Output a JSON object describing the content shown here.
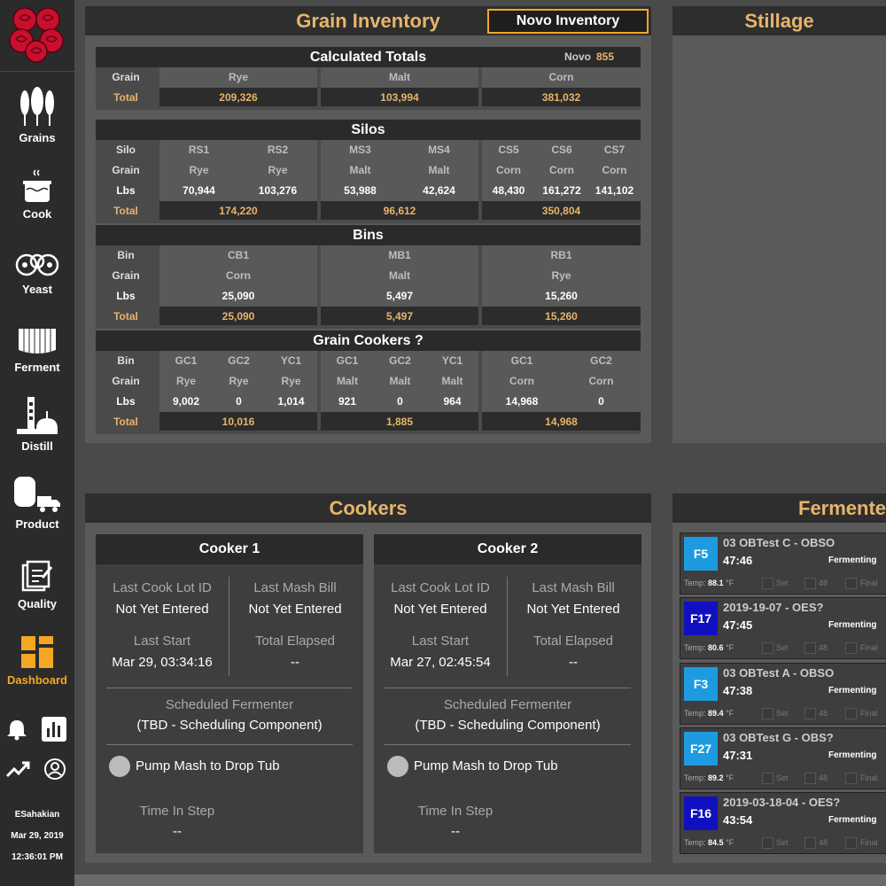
{
  "sidebar": {
    "items": [
      {
        "label": "Grains"
      },
      {
        "label": "Cook"
      },
      {
        "label": "Yeast"
      },
      {
        "label": "Ferment"
      },
      {
        "label": "Distill"
      },
      {
        "label": "Product"
      },
      {
        "label": "Quality"
      },
      {
        "label": "Dashboard"
      }
    ],
    "user": {
      "name": "ESahakian",
      "date": "Mar 29, 2019",
      "time": "12:36:01 PM"
    },
    "accent": "#f5a623"
  },
  "grain_inventory": {
    "title": "Grain Inventory",
    "novo_button": "Novo Inventory",
    "calculated": {
      "title": "Calculated Totals",
      "novo_label": "Novo",
      "novo_value": "855",
      "grain_label": "Grain",
      "total_label": "Total",
      "grains": [
        "Rye",
        "Malt",
        "Corn"
      ],
      "totals": [
        "209,326",
        "103,994",
        "381,032"
      ]
    },
    "silos": {
      "title": "Silos",
      "labels": [
        "Silo",
        "Grain",
        "Lbs",
        "Total"
      ],
      "names": [
        "RS1",
        "RS2",
        "MS3",
        "MS4",
        "CS5",
        "CS6",
        "CS7"
      ],
      "grains": [
        "Rye",
        "Rye",
        "Malt",
        "Malt",
        "Corn",
        "Corn",
        "Corn"
      ],
      "lbs": [
        "70,944",
        "103,276",
        "53,988",
        "42,624",
        "48,430",
        "161,272",
        "141,102"
      ],
      "totals": [
        "174,220",
        "96,612",
        "350,804"
      ]
    },
    "bins": {
      "title": "Bins",
      "labels": [
        "Bin",
        "Grain",
        "Lbs",
        "Total"
      ],
      "names": [
        "CB1",
        "MB1",
        "RB1"
      ],
      "grains": [
        "Corn",
        "Malt",
        "Rye"
      ],
      "lbs": [
        "25,090",
        "5,497",
        "15,260"
      ],
      "totals": [
        "25,090",
        "5,497",
        "15,260"
      ]
    },
    "cookers": {
      "title": "Grain Cookers ?",
      "labels": [
        "Bin",
        "Grain",
        "Lbs",
        "Total"
      ],
      "names": [
        "GC1",
        "GC2",
        "YC1",
        "GC1",
        "GC2",
        "YC1",
        "GC1",
        "GC2"
      ],
      "grains": [
        "Rye",
        "Rye",
        "Rye",
        "Malt",
        "Malt",
        "Malt",
        "Corn",
        "Corn"
      ],
      "lbs": [
        "9,002",
        "0",
        "1,014",
        "921",
        "0",
        "964",
        "14,968",
        "0"
      ],
      "totals": [
        "10,016",
        "1,885",
        "14,968"
      ]
    }
  },
  "stillage": {
    "title": "Stillage"
  },
  "cookers_panel": {
    "title": "Cookers",
    "cookers": [
      {
        "name": "Cooker 1",
        "lot_label": "Last Cook Lot ID",
        "lot_value": "Not Yet Entered",
        "bill_label": "Last Mash Bill",
        "bill_value": "Not Yet Entered",
        "start_label": "Last Start",
        "start_value": "Mar 29, 03:34:16",
        "elapsed_label": "Total Elapsed",
        "elapsed_value": "--",
        "sched_label": "Scheduled Fermenter",
        "sched_value": "(TBD - Scheduling Component)",
        "step": "Pump Mash to Drop Tub",
        "time_label": "Time In Step",
        "time_value": "--"
      },
      {
        "name": "Cooker 2",
        "lot_label": "Last Cook Lot ID",
        "lot_value": "Not Yet Entered",
        "bill_label": "Last Mash Bill",
        "bill_value": "Not Yet Entered",
        "start_label": "Last Start",
        "start_value": "Mar 27, 02:45:54",
        "elapsed_label": "Total Elapsed",
        "elapsed_value": "--",
        "sched_label": "Scheduled Fermenter",
        "sched_value": "(TBD - Scheduling Component)",
        "step": "Pump Mash to Drop Tub",
        "time_label": "Time In Step",
        "time_value": "--"
      }
    ]
  },
  "fermenters_panel": {
    "title": "Fermente",
    "labels": {
      "temp": "Temp:",
      "unit": "°F",
      "set": "Set",
      "mid": "48",
      "final": "Final"
    },
    "fermenters": [
      {
        "id": "F5",
        "name": "03 OBTest C - OBSO",
        "time": "47:46",
        "state": "Fermenting",
        "temp": "88.1",
        "color": "#1e9be0"
      },
      {
        "id": "F17",
        "name": "2019-19-07 - OES?",
        "time": "47:45",
        "state": "Fermenting",
        "temp": "80.6",
        "color": "#1010c0"
      },
      {
        "id": "F3",
        "name": "03 OBTest A - OBSO",
        "time": "47:38",
        "state": "Fermenting",
        "temp": "89.4",
        "color": "#1e9be0"
      },
      {
        "id": "F27",
        "name": "03 OBTest G - OBS?",
        "time": "47:31",
        "state": "Fermenting",
        "temp": "89.2",
        "color": "#1e9be0"
      },
      {
        "id": "F16",
        "name": "2019-03-18-04 - OES?",
        "time": "43:54",
        "state": "Fermenting",
        "temp": "84.5",
        "color": "#1010c0"
      }
    ]
  }
}
